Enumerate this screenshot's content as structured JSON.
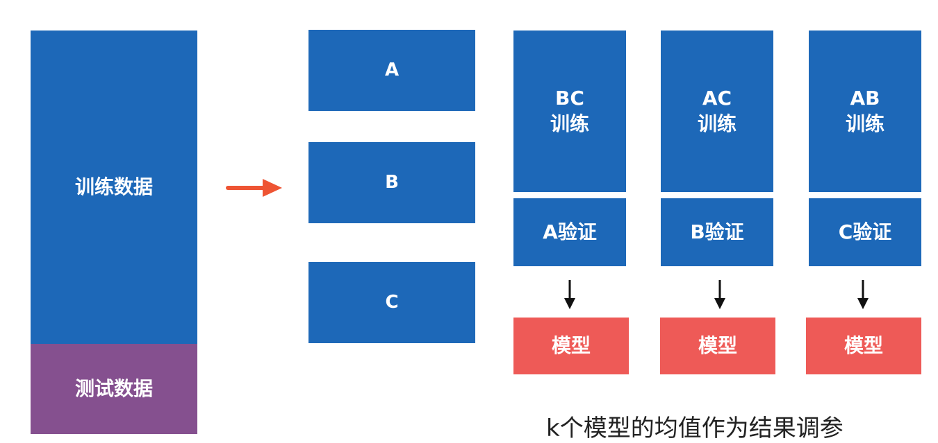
{
  "left": {
    "train_label": "训练数据",
    "test_label": "测试数据"
  },
  "splits": [
    "A",
    "B",
    "C"
  ],
  "folds": [
    {
      "train_line1": "BC",
      "train_line2": "训练",
      "validate": "A验证",
      "model": "模型"
    },
    {
      "train_line1": "AC",
      "train_line2": "训练",
      "validate": "B验证",
      "model": "模型"
    },
    {
      "train_line1": "AB",
      "train_line2": "训练",
      "validate": "C验证",
      "model": "模型"
    }
  ],
  "caption": "k个模型的均值作为结果调参",
  "colors": {
    "train_blue": "#1d68b8",
    "test_purple": "#85508f",
    "model_red": "#ee5a57",
    "arrow_orange": "#ee5433",
    "arrow_black": "#111111"
  }
}
